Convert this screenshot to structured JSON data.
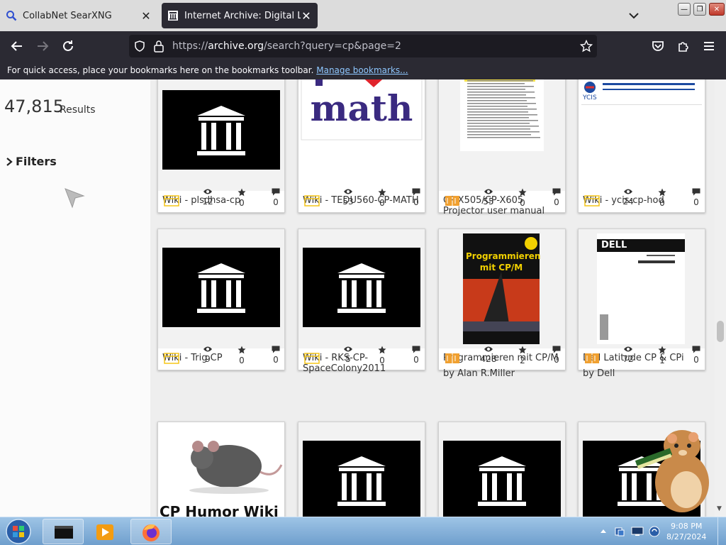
{
  "tabs": [
    {
      "title": "CollabNet SearXNG",
      "active": false
    },
    {
      "title": "Internet Archive: Digital Library",
      "active": true
    }
  ],
  "url": {
    "prefix": "https://",
    "host": "archive.org",
    "path": "/search?query=cp&page=2"
  },
  "bookmarks": {
    "message": "For quick access, place your bookmarks here on the bookmarks toolbar.",
    "link": "Manage bookmarks..."
  },
  "results": {
    "count": "47,815",
    "label": "Results"
  },
  "filters": {
    "label": "Filters"
  },
  "cards": [
    {
      "title": "Wiki - plsdhsa-cp",
      "by": "",
      "thumb": "ia-logo",
      "media": "web",
      "views": "12",
      "favs": "0",
      "reviews": "0"
    },
    {
      "title": "Wiki - TEDU560-CP-MATH",
      "by": "",
      "thumb": "math",
      "thumb_text": "math",
      "media": "web",
      "views": "53",
      "favs": "0",
      "reviews": "0"
    },
    {
      "title": "CP-X505/CP-X605 Projector user manual",
      "by": "",
      "thumb": "doc",
      "media": "texts",
      "views": "55",
      "favs": "0",
      "reviews": "0"
    },
    {
      "title": "Wiki - ycis-cp-hod",
      "by": "",
      "thumb": "ycis",
      "thumb_text": "YCIS",
      "media": "web",
      "views": "24",
      "favs": "0",
      "reviews": "0"
    },
    {
      "title": "Wiki - Trig CP",
      "by": "",
      "thumb": "ia-logo",
      "media": "web",
      "views": "9",
      "favs": "0",
      "reviews": "0"
    },
    {
      "title": "Wiki - RKS-CP-SpaceColony2011",
      "by": "",
      "thumb": "ia-logo",
      "media": "web",
      "views": "5",
      "favs": "0",
      "reviews": "0"
    },
    {
      "title": "Programmieren mit CP/M",
      "by": "by Alan R.Miller",
      "thumb": "book",
      "thumb_text": "Programmieren mit CP/M",
      "media": "texts",
      "views": "428",
      "favs": "2",
      "reviews": "0"
    },
    {
      "title": "Dell Latitude CP & CPi",
      "by": "by Dell",
      "thumb": "dell",
      "thumb_text": "DELL",
      "media": "texts",
      "views": "72",
      "favs": "1",
      "reviews": "0"
    },
    {
      "title": "",
      "by": "",
      "thumb": "rat",
      "thumb_text": "CP Humor Wiki",
      "media": "web",
      "views": "",
      "favs": "",
      "reviews": ""
    },
    {
      "title": "",
      "by": "",
      "thumb": "ia-logo",
      "media": "web",
      "views": "",
      "favs": "",
      "reviews": ""
    },
    {
      "title": "",
      "by": "",
      "thumb": "ia-logo",
      "media": "web",
      "views": "",
      "favs": "",
      "reviews": ""
    },
    {
      "title": "",
      "by": "",
      "thumb": "ia-logo",
      "media": "web",
      "views": "",
      "favs": "",
      "reviews": ""
    }
  ],
  "clock": {
    "time": "9:08 PM",
    "date": "8/27/2024"
  },
  "colors": {
    "tab_active": "#2b2a33",
    "web_icon": "#f5c518",
    "texts_icon": "#f0a030",
    "link": "#8ec7ff"
  }
}
